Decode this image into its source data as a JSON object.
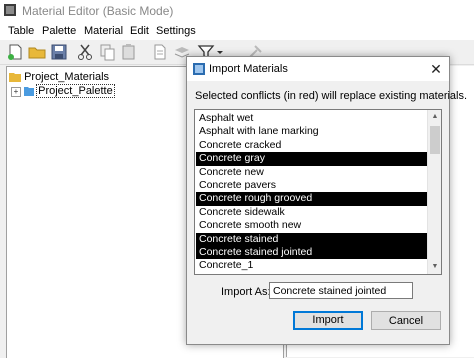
{
  "window": {
    "title": "Material Editor (Basic Mode)"
  },
  "menu": [
    "Table",
    "Palette",
    "Material",
    "Edit",
    "Settings"
  ],
  "toolbar": [
    "new-icon",
    "open-folder-icon",
    "save-icon",
    "cut-icon",
    "copy-icon",
    "paste-icon",
    "document-icon",
    "stack-icon",
    "filter-icon",
    "disabled-tool-icon"
  ],
  "tree": {
    "root": {
      "label": "Project_Materials",
      "icon": "folder-icon"
    },
    "child": {
      "label": "Project_Palette",
      "expander": "+",
      "icon": "palette-icon"
    }
  },
  "dialog": {
    "title": "Import Materials",
    "close": "✕",
    "message": "Selected conflicts (in red) will replace existing materials.",
    "items": [
      {
        "label": "Asphalt wet",
        "conflict": false
      },
      {
        "label": "Asphalt with lane marking",
        "conflict": false
      },
      {
        "label": "Concrete cracked",
        "conflict": false
      },
      {
        "label": "Concrete gray",
        "conflict": true
      },
      {
        "label": "Concrete new",
        "conflict": false
      },
      {
        "label": "Concrete pavers",
        "conflict": false
      },
      {
        "label": "Concrete rough grooved",
        "conflict": true
      },
      {
        "label": "Concrete sidewalk",
        "conflict": false
      },
      {
        "label": "Concrete smooth new",
        "conflict": false
      },
      {
        "label": "Concrete stained",
        "conflict": true
      },
      {
        "label": "Concrete stained jointed",
        "conflict": true
      },
      {
        "label": "Concrete_1",
        "conflict": false
      }
    ],
    "scroll": {
      "up": "▲",
      "down": "▼"
    },
    "import_as": {
      "label": "Import As:",
      "value": "Concrete stained jointed"
    },
    "buttons": {
      "import": "Import",
      "cancel": "Cancel"
    }
  },
  "colors": {
    "conflict_bg": "#000000",
    "default_button_border": "#0078d7",
    "folder": "#e8b83a"
  }
}
